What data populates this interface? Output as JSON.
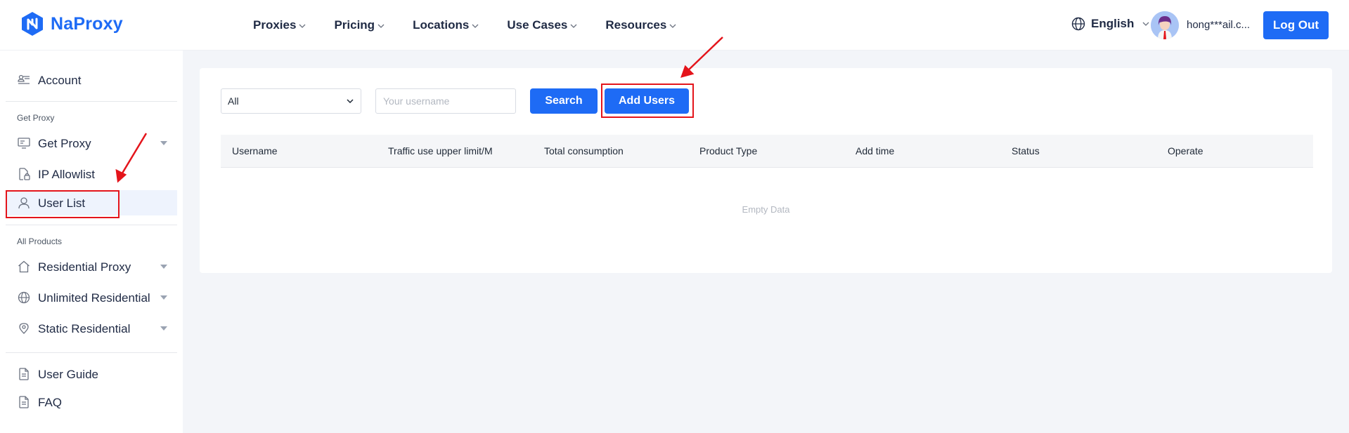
{
  "brand": {
    "name": "NaProxy",
    "color": "#1e6bf5"
  },
  "nav": {
    "items": [
      {
        "label": "Proxies",
        "icon": "chevron-down-icon"
      },
      {
        "label": "Pricing",
        "icon": "chevron-down-icon"
      },
      {
        "label": "Locations",
        "icon": "chevron-down-icon"
      },
      {
        "label": "Use Cases",
        "icon": "chevron-down-icon"
      },
      {
        "label": "Resources",
        "icon": "chevron-down-icon"
      }
    ]
  },
  "header": {
    "language": "English",
    "user_email": "hong***ail.c...",
    "logout_label": "Log Out"
  },
  "sidebar": {
    "account": "Account",
    "section_get_proxy": "Get Proxy",
    "items_get_proxy": [
      {
        "label": "Get Proxy",
        "icon": "monitor-icon",
        "expandable": true
      },
      {
        "label": "IP Allowlist",
        "icon": "lock-file-icon",
        "expandable": false
      },
      {
        "label": "User List",
        "icon": "user-icon",
        "expandable": false,
        "active": true
      }
    ],
    "section_all_products": "All Products",
    "items_products": [
      {
        "label": "Residential Proxy",
        "icon": "home-icon",
        "expandable": true
      },
      {
        "label": "Unlimited Residential",
        "icon": "globe-icon",
        "expandable": true
      },
      {
        "label": "Static Residential",
        "icon": "location-pin-icon",
        "expandable": true
      }
    ],
    "items_help": [
      {
        "label": "User Guide",
        "icon": "document-icon"
      },
      {
        "label": "FAQ",
        "icon": "document-icon"
      }
    ]
  },
  "toolbar": {
    "filter_value": "All",
    "search_placeholder": "Your username",
    "search_label": "Search",
    "add_users_label": "Add Users"
  },
  "table": {
    "columns": [
      "Username",
      "Traffic use upper limit/M",
      "Total consumption",
      "Product Type",
      "Add time",
      "Status",
      "Operate"
    ],
    "empty_text": "Empty Data"
  },
  "colors": {
    "accent": "#1e6bf5",
    "annotation": "#e4141b"
  }
}
